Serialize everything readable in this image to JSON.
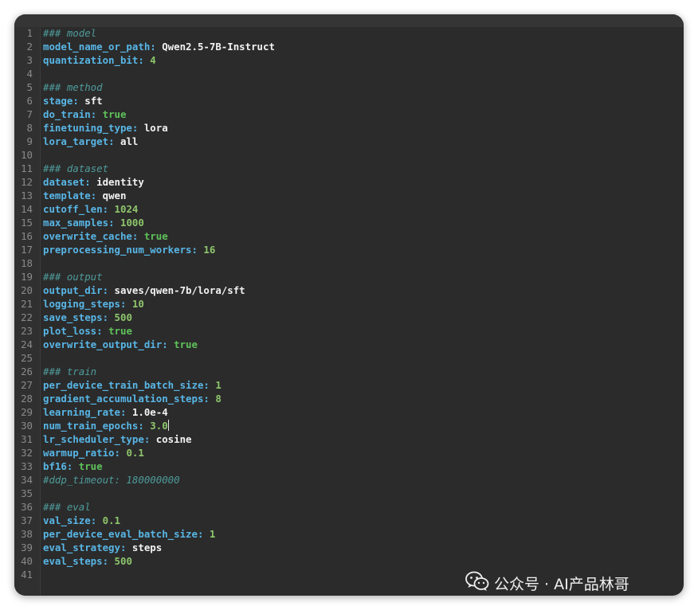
{
  "lines": [
    [
      {
        "t": "### model",
        "c": "comment"
      }
    ],
    [
      {
        "t": "model_name_or_path",
        "c": "key"
      },
      {
        "t": ": ",
        "c": "punct"
      },
      {
        "t": "Qwen2.5-7B-Instruct",
        "c": "str"
      }
    ],
    [
      {
        "t": "quantization_bit",
        "c": "key"
      },
      {
        "t": ": ",
        "c": "punct"
      },
      {
        "t": "4",
        "c": "num"
      }
    ],
    [],
    [
      {
        "t": "### method",
        "c": "comment"
      }
    ],
    [
      {
        "t": "stage",
        "c": "key"
      },
      {
        "t": ": ",
        "c": "punct"
      },
      {
        "t": "sft",
        "c": "str"
      }
    ],
    [
      {
        "t": "do_train",
        "c": "key"
      },
      {
        "t": ": ",
        "c": "punct"
      },
      {
        "t": "true",
        "c": "bool"
      }
    ],
    [
      {
        "t": "finetuning_type",
        "c": "key"
      },
      {
        "t": ": ",
        "c": "punct"
      },
      {
        "t": "lora",
        "c": "str"
      }
    ],
    [
      {
        "t": "lora_target",
        "c": "key"
      },
      {
        "t": ": ",
        "c": "punct"
      },
      {
        "t": "all",
        "c": "str"
      }
    ],
    [],
    [
      {
        "t": "### dataset",
        "c": "comment"
      }
    ],
    [
      {
        "t": "dataset",
        "c": "key"
      },
      {
        "t": ": ",
        "c": "punct"
      },
      {
        "t": "identity",
        "c": "str"
      }
    ],
    [
      {
        "t": "template",
        "c": "key"
      },
      {
        "t": ": ",
        "c": "punct"
      },
      {
        "t": "qwen",
        "c": "str"
      }
    ],
    [
      {
        "t": "cutoff_len",
        "c": "key"
      },
      {
        "t": ": ",
        "c": "punct"
      },
      {
        "t": "1024",
        "c": "num"
      }
    ],
    [
      {
        "t": "max_samples",
        "c": "key"
      },
      {
        "t": ": ",
        "c": "punct"
      },
      {
        "t": "1000",
        "c": "num"
      }
    ],
    [
      {
        "t": "overwrite_cache",
        "c": "key"
      },
      {
        "t": ": ",
        "c": "punct"
      },
      {
        "t": "true",
        "c": "bool"
      }
    ],
    [
      {
        "t": "preprocessing_num_workers",
        "c": "key"
      },
      {
        "t": ": ",
        "c": "punct"
      },
      {
        "t": "16",
        "c": "num"
      }
    ],
    [],
    [
      {
        "t": "### output",
        "c": "comment"
      }
    ],
    [
      {
        "t": "output_dir",
        "c": "key"
      },
      {
        "t": ": ",
        "c": "punct"
      },
      {
        "t": "saves/qwen-7b/lora/sft",
        "c": "str"
      }
    ],
    [
      {
        "t": "logging_steps",
        "c": "key"
      },
      {
        "t": ": ",
        "c": "punct"
      },
      {
        "t": "10",
        "c": "num"
      }
    ],
    [
      {
        "t": "save_steps",
        "c": "key"
      },
      {
        "t": ": ",
        "c": "punct"
      },
      {
        "t": "500",
        "c": "num"
      }
    ],
    [
      {
        "t": "plot_loss",
        "c": "key"
      },
      {
        "t": ": ",
        "c": "punct"
      },
      {
        "t": "true",
        "c": "bool"
      }
    ],
    [
      {
        "t": "overwrite_output_dir",
        "c": "key"
      },
      {
        "t": ": ",
        "c": "punct"
      },
      {
        "t": "true",
        "c": "bool"
      }
    ],
    [],
    [
      {
        "t": "### train",
        "c": "comment"
      }
    ],
    [
      {
        "t": "per_device_train_batch_size",
        "c": "key"
      },
      {
        "t": ": ",
        "c": "punct"
      },
      {
        "t": "1",
        "c": "num"
      }
    ],
    [
      {
        "t": "gradient_accumulation_steps",
        "c": "key"
      },
      {
        "t": ": ",
        "c": "punct"
      },
      {
        "t": "8",
        "c": "num"
      }
    ],
    [
      {
        "t": "learning_rate",
        "c": "key"
      },
      {
        "t": ": ",
        "c": "punct"
      },
      {
        "t": "1.0e-4",
        "c": "str"
      }
    ],
    [
      {
        "t": "num_train_epochs",
        "c": "key"
      },
      {
        "t": ": ",
        "c": "punct"
      },
      {
        "t": "3.0",
        "c": "num"
      }
    ],
    [
      {
        "t": "lr_scheduler_type",
        "c": "key"
      },
      {
        "t": ": ",
        "c": "punct"
      },
      {
        "t": "cosine",
        "c": "str"
      }
    ],
    [
      {
        "t": "warmup_ratio",
        "c": "key"
      },
      {
        "t": ": ",
        "c": "punct"
      },
      {
        "t": "0.1",
        "c": "num"
      }
    ],
    [
      {
        "t": "bf16",
        "c": "key"
      },
      {
        "t": ": ",
        "c": "punct"
      },
      {
        "t": "true",
        "c": "bool"
      }
    ],
    [
      {
        "t": "#ddp_timeout: 180000000",
        "c": "comment"
      }
    ],
    [],
    [
      {
        "t": "### eval",
        "c": "comment"
      }
    ],
    [
      {
        "t": "val_size",
        "c": "key"
      },
      {
        "t": ": ",
        "c": "punct"
      },
      {
        "t": "0.1",
        "c": "num"
      }
    ],
    [
      {
        "t": "per_device_eval_batch_size",
        "c": "key"
      },
      {
        "t": ": ",
        "c": "punct"
      },
      {
        "t": "1",
        "c": "num"
      }
    ],
    [
      {
        "t": "eval_strategy",
        "c": "key"
      },
      {
        "t": ": ",
        "c": "punct"
      },
      {
        "t": "steps",
        "c": "str"
      }
    ],
    [
      {
        "t": "eval_steps",
        "c": "key"
      },
      {
        "t": ": ",
        "c": "punct"
      },
      {
        "t": "500",
        "c": "num"
      }
    ],
    []
  ],
  "cursor_line": 30,
  "colors": {
    "background": "#2b2b2b",
    "key": "#58b6e6",
    "string": "#f2f2f2",
    "number": "#8ec66c",
    "boolean": "#5fc25a",
    "comment": "#4f9b9b",
    "line_number": "#8a8a8a"
  },
  "watermark": {
    "icon": "wechat-icon",
    "text": "公众号 · AI产品林哥"
  }
}
